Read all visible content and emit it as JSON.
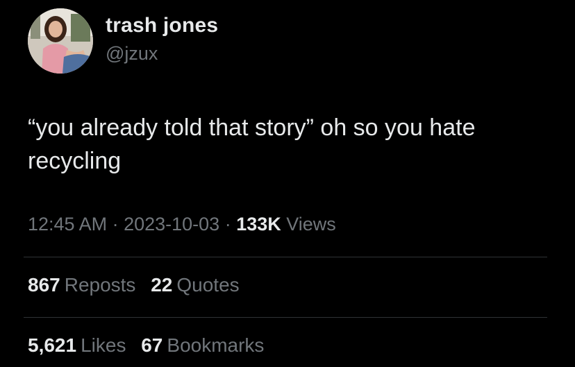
{
  "user": {
    "display_name": "trash jones",
    "handle": "@jzux",
    "avatar_icon": "profile-photo"
  },
  "tweet": {
    "text_line1": "“you already told that story” oh so you hate",
    "text_line2": "recycling"
  },
  "meta": {
    "time": "12:45 AM",
    "separator1": " · ",
    "date": "2023-10-03",
    "separator2": " · ",
    "views_count": "133K",
    "views_label": "Views"
  },
  "stats": {
    "reposts_count": "867",
    "reposts_label": "Reposts",
    "quotes_count": "22",
    "quotes_label": "Quotes",
    "likes_count": "5,621",
    "likes_label": "Likes",
    "bookmarks_count": "67",
    "bookmarks_label": "Bookmarks"
  },
  "colors": {
    "background": "#000000",
    "primary_text": "#e7e9ea",
    "secondary_text": "#71767b",
    "divider": "#2f3336"
  }
}
